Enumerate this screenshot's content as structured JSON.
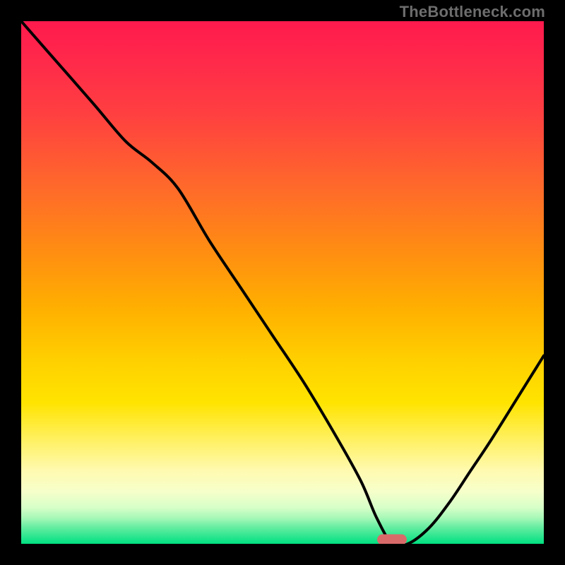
{
  "watermark": "TheBottleneck.com",
  "colors": {
    "frame": "#000000",
    "gradient_top": "#ff1a4d",
    "gradient_bottom": "#00e080",
    "curve": "#000000",
    "marker": "#d96a6a"
  },
  "chart_data": {
    "type": "line",
    "title": "",
    "xlabel": "",
    "ylabel": "",
    "xlim": [
      0,
      100
    ],
    "ylim": [
      0,
      100
    ],
    "grid": false,
    "legend": false,
    "marker": {
      "x": 71,
      "y": 0,
      "width_pct": 6
    },
    "series": [
      {
        "name": "curve",
        "x": [
          0,
          7,
          14,
          20,
          25,
          30,
          36,
          42,
          48,
          54,
          60,
          65,
          68,
          71,
          74,
          78,
          82,
          86,
          90,
          95,
          100
        ],
        "values": [
          100,
          92,
          84,
          77,
          73,
          68,
          58,
          49,
          40,
          31,
          21,
          12,
          5,
          0,
          0,
          3,
          8,
          14,
          20,
          28,
          36
        ]
      }
    ]
  }
}
